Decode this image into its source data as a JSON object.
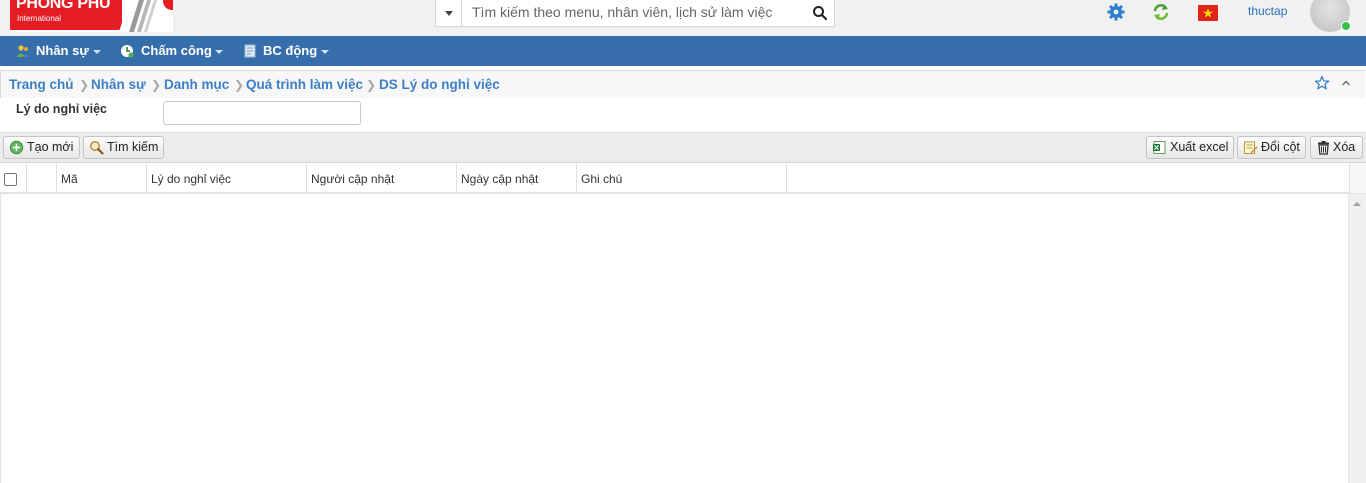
{
  "header": {
    "logo_title": "PHONG PHU",
    "logo_subtitle": "International",
    "search": {
      "placeholder": "Tìm kiếm theo menu, nhân viên, lịch sử làm việc"
    },
    "icons": [
      "gear-icon",
      "refresh-icon",
      "vietnam-flag-icon"
    ],
    "username": "thuctap",
    "online_status_color": "#36c24a"
  },
  "nav": {
    "items": [
      {
        "label": "Nhân sự",
        "icon": "users-icon"
      },
      {
        "label": "Chấm công",
        "icon": "clock-icon"
      },
      {
        "label": "BC động",
        "icon": "report-icon"
      }
    ],
    "background": "#356eaa"
  },
  "breadcrumb": {
    "items": [
      "Trang chủ",
      "Nhân sự",
      "Danh mục",
      "Quá trình làm việc",
      "DS Lý do nghỉ việc"
    ],
    "separator": "❯",
    "color": "#3d7fc6"
  },
  "filter": {
    "label": "Lý do nghỉ việc",
    "value": ""
  },
  "toolbar": {
    "create_label": "Tạo mới",
    "search_label": "Tìm kiếm",
    "export_label": "Xuất excel",
    "columns_label": "Đổi cột",
    "delete_label": "Xóa"
  },
  "grid": {
    "columns": [
      "Mã",
      "Lý do nghỉ việc",
      "Người cập nhật",
      "Ngày cập nhật",
      "Ghi chú"
    ],
    "rows": []
  }
}
